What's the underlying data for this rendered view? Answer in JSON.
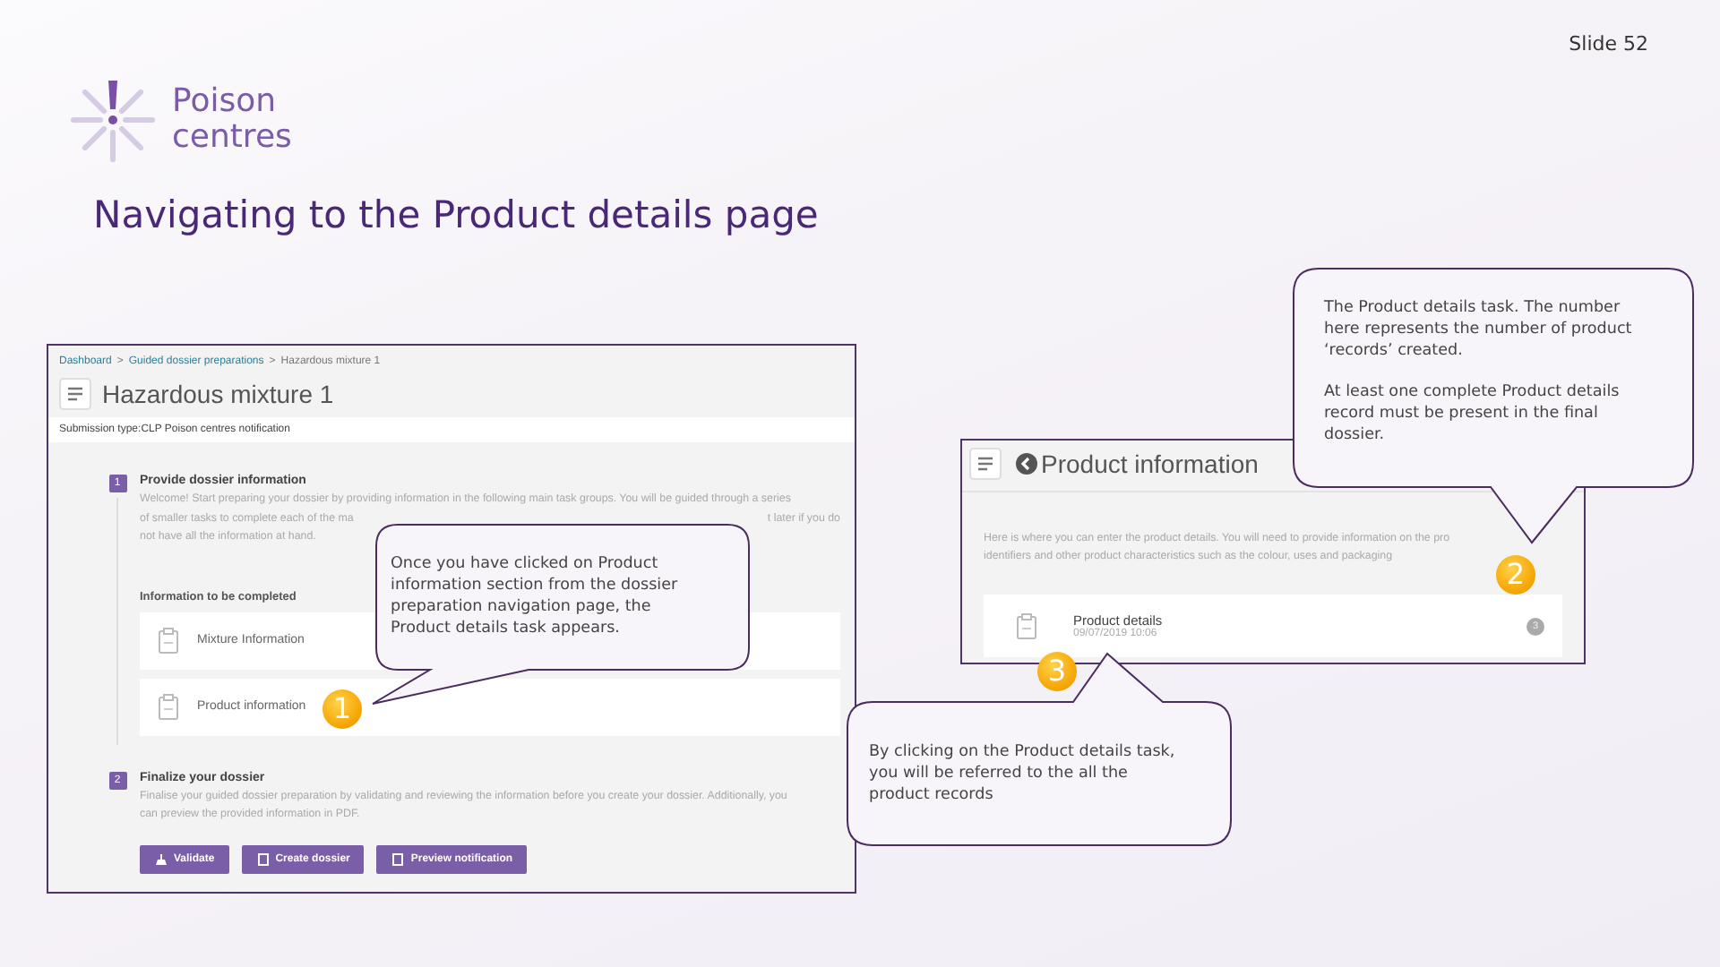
{
  "slide_number": "Slide 52",
  "logo": {
    "line_1": "Poison",
    "line_2": "centres"
  },
  "title": "Navigating to the Product details page",
  "dossier_screen": {
    "breadcrumb": {
      "separator": ">",
      "items": [
        "Dashboard",
        "Guided dossier preparations",
        "Hazardous mixture 1"
      ]
    },
    "page_title": "Hazardous mixture 1",
    "submission_type": "Submission type:CLP Poison centres notification",
    "steps": [
      {
        "number": "1",
        "title": "Provide dossier information",
        "lines": [
          [
            "Welcome! Start preparing your dossier by providing information in the following main task groups. You will be guided through a series"
          ],
          [
            "of smaller tasks to complete each of the ma",
            "t later if you do"
          ],
          [
            "not have all the information at hand."
          ]
        ],
        "section_label": "Information to be completed",
        "tasks": [
          "Mixture Information",
          "Product information"
        ]
      },
      {
        "number": "2",
        "title": "Finalize your dossier",
        "lines": [
          [
            "Finalise your guided dossier preparation by validating and reviewing the information before you create your dossier. Additionally, you"
          ],
          [
            "can preview the provided information in PDF."
          ]
        ],
        "buttons": [
          "Validate",
          "Create dossier",
          "Preview notification"
        ]
      }
    ]
  },
  "product_screen": {
    "page_title": "Product information",
    "lines": [
      "Here is where you can enter the product details. You will need to provide information on the pro",
      "identifiers and other product characteristics such as the colour, uses and packaging"
    ],
    "task": {
      "title": "Product details",
      "date": "09/07/2019 10:06",
      "count": "3"
    }
  },
  "callouts": [
    {
      "paragraphs": [
        "The Product details task. The number here represents the number of product ‘records’ created.",
        "At least one complete Product details record must be present in the final dossier."
      ]
    },
    {
      "paragraphs": [
        "Once you have clicked on Product information section from the dossier preparation navigation page, the Product details task appears."
      ]
    },
    {
      "paragraphs": [
        "By clicking on the Product details task, you will be referred to the all the product records"
      ]
    }
  ],
  "markers": [
    "1",
    "2",
    "3"
  ]
}
